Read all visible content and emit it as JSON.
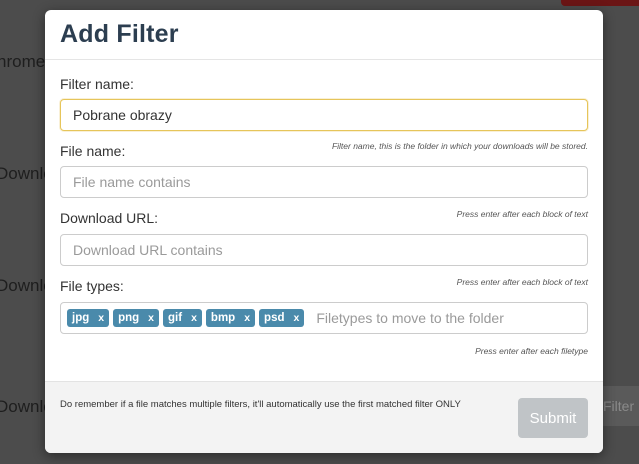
{
  "background": {
    "texts": [
      "hrome",
      "Downlo",
      "Downlo",
      "Downlo"
    ],
    "filter_button_label": "Filter"
  },
  "modal": {
    "title": "Add Filter",
    "filter_name": {
      "label": "Filter name:",
      "value": "Pobrane obrazy"
    },
    "file_name": {
      "label": "File name:",
      "hint": "Filter name, this is the folder in which your downloads will be stored.",
      "placeholder": "File name contains"
    },
    "download_url": {
      "label": "Download URL:",
      "hint": "Press enter after each block of text",
      "placeholder": "Download URL contains"
    },
    "file_types": {
      "label": "File types:",
      "hint": "Press enter after each block of text",
      "tags": [
        "jpg",
        "png",
        "gif",
        "bmp",
        "psd"
      ],
      "remove_glyph": "x",
      "placeholder": "Filetypes to move to the folder",
      "footer_hint": "Press enter after each filetype"
    },
    "footer": {
      "note": "Do remember if a file matches multiple filters, it'll automatically use the first matched filter ONLY",
      "submit_label": "Submit"
    }
  },
  "colors": {
    "title": "#2c3e50",
    "tag": "#4a8aab",
    "focus_border": "#e6c55a",
    "submit_disabled": "#c0c4c7",
    "overlay": "#4c4c4c"
  }
}
